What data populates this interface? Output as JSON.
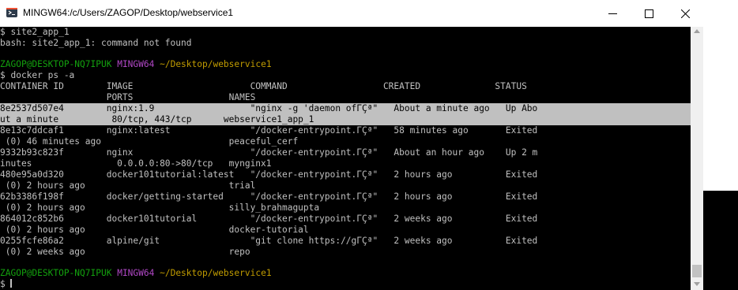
{
  "window": {
    "title": "MINGW64:/c/Users/ZAGOP/Desktop/webservice1"
  },
  "terminal": {
    "lines": [
      "$ site2_app_1",
      "bash: site2_app_1: command not found",
      "",
      "",
      "$ docker ps -a",
      "CONTAINER ID        IMAGE                      COMMAND                  CREATED              STATUS",
      "                    PORTS                  NAMES",
      "8e2537d507e4        nginx:1.9                  \"nginx -g 'daemon ofΓÇª\"   About a minute ago   Up Abo",
      "ut a minute          80/tcp, 443/tcp      webservice1_app_1",
      "8e13c7ddcaf1        nginx:latest               \"/docker-entrypoint.ΓÇª\"   58 minutes ago       Exited",
      " (0) 46 minutes ago                        peaceful_cerf",
      "9332b93c823f        nginx                      \"/docker-entrypoint.ΓÇª\"   About an hour ago    Up 2 m",
      "inutes                0.0.0.0:80->80/tcp   mynginx1",
      "480e95a0d320        docker101tutorial:latest   \"/docker-entrypoint.ΓÇª\"   2 hours ago          Exited",
      " (0) 2 hours ago                           trial",
      "62b3386f198f        docker/getting-started     \"/docker-entrypoint.ΓÇª\"   2 hours ago          Exited",
      " (0) 2 hours ago                           silly_brahmagupta",
      "864012c852b6        docker101tutorial          \"/docker-entrypoint.ΓÇª\"   2 weeks ago          Exited",
      " (0) 2 hours ago                           docker-tutorial",
      "0255fcfe86a2        alpine/git                 \"git clone https://gΓÇª\"   2 weeks ago          Exited",
      " (0) 2 weeks ago                           repo",
      "",
      "",
      "$ "
    ],
    "prompt": {
      "user": "ZAGOP@DESKTOP-NQ7IPUK",
      "shell": "MINGW64",
      "path": "~/Desktop/webservice1"
    }
  },
  "colors": {
    "background": "#000000",
    "text": "#c0c0c0",
    "prompt_user": "#13a10e",
    "prompt_shell": "#b148c6",
    "prompt_path": "#c19c00",
    "selection": "#c0c0c0"
  },
  "icons": [
    "git-bash-icon",
    "minimize-icon",
    "maximize-icon",
    "close-icon"
  ]
}
